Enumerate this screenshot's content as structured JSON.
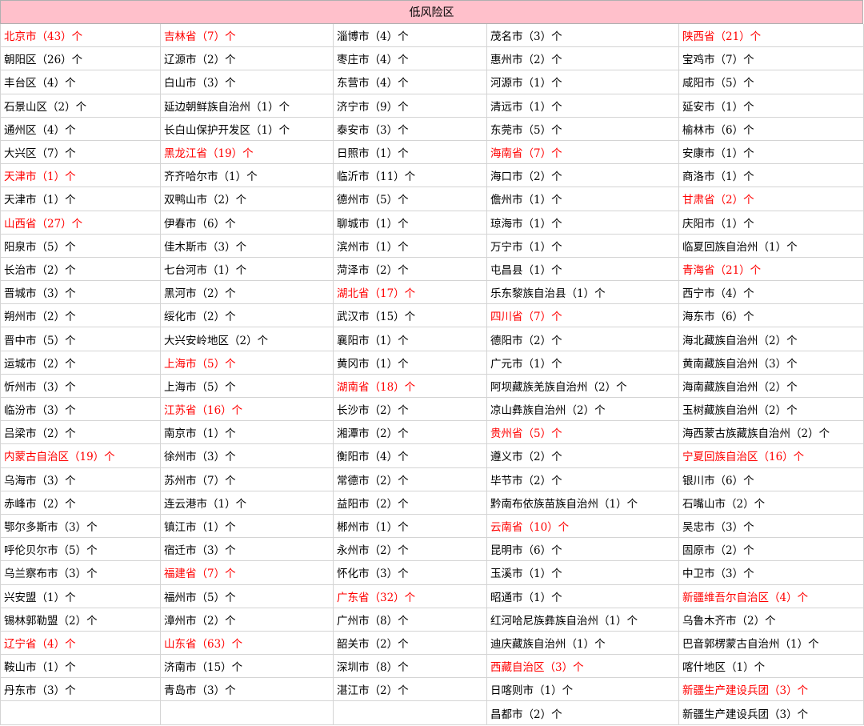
{
  "title": "低风险区",
  "highlight_color": "#ff0000",
  "header_bg": "#ffc0cb",
  "columns": [
    [
      {
        "t": "北京市（43）个",
        "r": 1
      },
      {
        "t": "朝阳区（26）个"
      },
      {
        "t": "丰台区（4）个"
      },
      {
        "t": "石景山区（2）个"
      },
      {
        "t": "通州区（4）个"
      },
      {
        "t": "大兴区（7）个"
      },
      {
        "t": "天津市（1）个",
        "r": 1
      },
      {
        "t": "天津市（1）个"
      },
      {
        "t": "山西省（27）个",
        "r": 1
      },
      {
        "t": "阳泉市（5）个"
      },
      {
        "t": "长治市（2）个"
      },
      {
        "t": "晋城市（3）个"
      },
      {
        "t": "朔州市（2）个"
      },
      {
        "t": "晋中市（5）个"
      },
      {
        "t": "运城市（2）个"
      },
      {
        "t": "忻州市（3）个"
      },
      {
        "t": "临汾市（3）个"
      },
      {
        "t": "吕梁市（2）个"
      },
      {
        "t": "内蒙古自治区（19）个",
        "r": 1
      },
      {
        "t": "乌海市（3）个"
      },
      {
        "t": "赤峰市（2）个"
      },
      {
        "t": "鄂尔多斯市（3）个"
      },
      {
        "t": "呼伦贝尔市（5）个"
      },
      {
        "t": "乌兰察布市（3）个"
      },
      {
        "t": "兴安盟（1）个"
      },
      {
        "t": "锡林郭勒盟（2）个"
      },
      {
        "t": "辽宁省（4）个",
        "r": 1
      },
      {
        "t": "鞍山市（1）个"
      },
      {
        "t": "丹东市（3）个"
      },
      {
        "t": ""
      }
    ],
    [
      {
        "t": "吉林省（7）个",
        "r": 1
      },
      {
        "t": "辽源市（2）个"
      },
      {
        "t": "白山市（3）个"
      },
      {
        "t": "延边朝鲜族自治州（1）个"
      },
      {
        "t": "长白山保护开发区（1）个"
      },
      {
        "t": "黑龙江省（19）个",
        "r": 1
      },
      {
        "t": "齐齐哈尔市（1）个"
      },
      {
        "t": "双鸭山市（2）个"
      },
      {
        "t": "伊春市（6）个"
      },
      {
        "t": "佳木斯市（3）个"
      },
      {
        "t": "七台河市（1）个"
      },
      {
        "t": "黑河市（2）个"
      },
      {
        "t": "绥化市（2）个"
      },
      {
        "t": "大兴安岭地区（2）个"
      },
      {
        "t": "上海市（5）个",
        "r": 1
      },
      {
        "t": "上海市（5）个"
      },
      {
        "t": "江苏省（16）个",
        "r": 1
      },
      {
        "t": "南京市（1）个"
      },
      {
        "t": "徐州市（3）个"
      },
      {
        "t": "苏州市（7）个"
      },
      {
        "t": "连云港市（1）个"
      },
      {
        "t": "镇江市（1）个"
      },
      {
        "t": "宿迁市（3）个"
      },
      {
        "t": "福建省（7）个",
        "r": 1
      },
      {
        "t": "福州市（5）个"
      },
      {
        "t": "漳州市（2）个"
      },
      {
        "t": "山东省（63）个",
        "r": 1
      },
      {
        "t": "济南市（15）个"
      },
      {
        "t": "青岛市（3）个"
      },
      {
        "t": ""
      }
    ],
    [
      {
        "t": "淄博市（4）个"
      },
      {
        "t": "枣庄市（4）个"
      },
      {
        "t": "东营市（4）个"
      },
      {
        "t": "济宁市（9）个"
      },
      {
        "t": "泰安市（3）个"
      },
      {
        "t": "日照市（1）个"
      },
      {
        "t": "临沂市（11）个"
      },
      {
        "t": "德州市（5）个"
      },
      {
        "t": "聊城市（1）个"
      },
      {
        "t": "滨州市（1）个"
      },
      {
        "t": "菏泽市（2）个"
      },
      {
        "t": "湖北省（17）个",
        "r": 1
      },
      {
        "t": "武汉市（15）个"
      },
      {
        "t": "襄阳市（1）个"
      },
      {
        "t": "黄冈市（1）个"
      },
      {
        "t": "湖南省（18）个",
        "r": 1
      },
      {
        "t": "长沙市（2）个"
      },
      {
        "t": "湘潭市（2）个"
      },
      {
        "t": "衡阳市（4）个"
      },
      {
        "t": "常德市（2）个"
      },
      {
        "t": "益阳市（2）个"
      },
      {
        "t": "郴州市（1）个"
      },
      {
        "t": "永州市（2）个"
      },
      {
        "t": "怀化市（3）个"
      },
      {
        "t": "广东省（32）个",
        "r": 1
      },
      {
        "t": "广州市（8）个"
      },
      {
        "t": "韶关市（2）个"
      },
      {
        "t": "深圳市（8）个"
      },
      {
        "t": "湛江市（2）个"
      },
      {
        "t": ""
      }
    ],
    [
      {
        "t": "茂名市（3）个"
      },
      {
        "t": "惠州市（2）个"
      },
      {
        "t": "河源市（1）个"
      },
      {
        "t": "清远市（1）个"
      },
      {
        "t": "东莞市（5）个"
      },
      {
        "t": "海南省（7）个",
        "r": 1
      },
      {
        "t": "海口市（2）个"
      },
      {
        "t": "儋州市（1）个"
      },
      {
        "t": "琼海市（1）个"
      },
      {
        "t": "万宁市（1）个"
      },
      {
        "t": "屯昌县（1）个"
      },
      {
        "t": "乐东黎族自治县（1）个"
      },
      {
        "t": "四川省（7）个",
        "r": 1
      },
      {
        "t": "德阳市（2）个"
      },
      {
        "t": "广元市（1）个"
      },
      {
        "t": "阿坝藏族羌族自治州（2）个"
      },
      {
        "t": "凉山彝族自治州（2）个"
      },
      {
        "t": "贵州省（5）个",
        "r": 1
      },
      {
        "t": "遵义市（2）个"
      },
      {
        "t": "毕节市（2）个"
      },
      {
        "t": "黔南布依族苗族自治州（1）个"
      },
      {
        "t": "云南省（10）个",
        "r": 1
      },
      {
        "t": "昆明市（6）个"
      },
      {
        "t": "玉溪市（1）个"
      },
      {
        "t": "昭通市（1）个"
      },
      {
        "t": "红河哈尼族彝族自治州（1）个"
      },
      {
        "t": "迪庆藏族自治州（1）个"
      },
      {
        "t": "西藏自治区（3）个",
        "r": 1
      },
      {
        "t": "日喀则市（1）个"
      },
      {
        "t": "昌都市（2）个"
      }
    ],
    [
      {
        "t": "陕西省（21）个",
        "r": 1
      },
      {
        "t": "宝鸡市（7）个"
      },
      {
        "t": "咸阳市（5）个"
      },
      {
        "t": "延安市（1）个"
      },
      {
        "t": "榆林市（6）个"
      },
      {
        "t": "安康市（1）个"
      },
      {
        "t": "商洛市（1）个"
      },
      {
        "t": "甘肃省（2）个",
        "r": 1
      },
      {
        "t": "庆阳市（1）个"
      },
      {
        "t": "临夏回族自治州（1）个"
      },
      {
        "t": "青海省（21）个",
        "r": 1
      },
      {
        "t": "西宁市（4）个"
      },
      {
        "t": "海东市（6）个"
      },
      {
        "t": "海北藏族自治州（2）个"
      },
      {
        "t": "黄南藏族自治州（3）个"
      },
      {
        "t": "海南藏族自治州（2）个"
      },
      {
        "t": "玉树藏族自治州（2）个"
      },
      {
        "t": "海西蒙古族藏族自治州（2）个"
      },
      {
        "t": "宁夏回族自治区（16）个",
        "r": 1
      },
      {
        "t": "银川市（6）个"
      },
      {
        "t": "石嘴山市（2）个"
      },
      {
        "t": "吴忠市（3）个"
      },
      {
        "t": "固原市（2）个"
      },
      {
        "t": "中卫市（3）个"
      },
      {
        "t": "新疆维吾尔自治区（4）个",
        "r": 1
      },
      {
        "t": "乌鲁木齐市（2）个"
      },
      {
        "t": "巴音郭楞蒙古自治州（1）个"
      },
      {
        "t": "喀什地区（1）个"
      },
      {
        "t": "新疆生产建设兵团（3）个",
        "r": 1
      },
      {
        "t": "新疆生产建设兵团（3）个"
      }
    ]
  ]
}
